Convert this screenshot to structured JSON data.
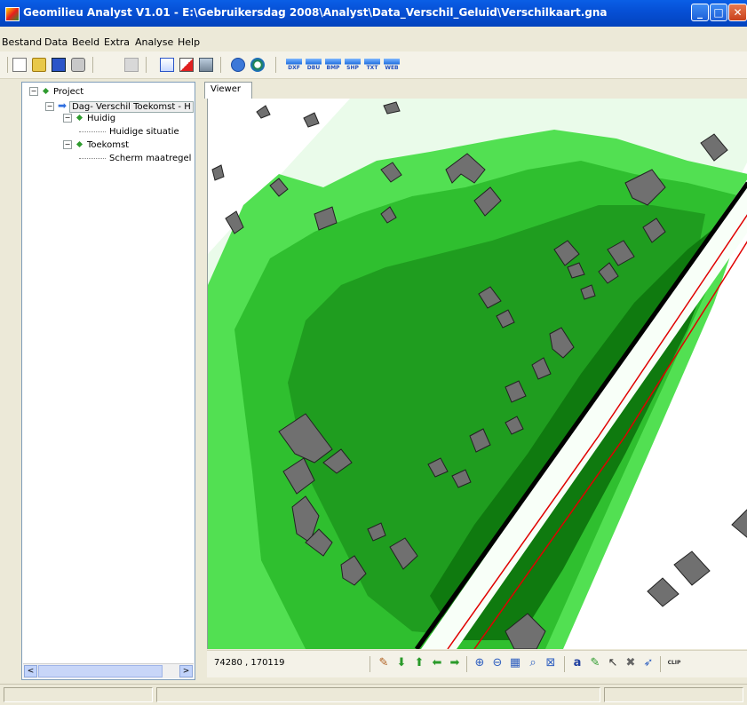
{
  "window": {
    "title": "Geomilieu Analyst V1.01 - E:\\Gebruikersdag 2008\\Analyst\\Data_Verschil_Geluid\\Verschilkaart.gna",
    "app_icon": "geomilieu-logo-icon",
    "controls": [
      "minimize-icon",
      "maximize-icon",
      "close-icon"
    ]
  },
  "menu": {
    "items": [
      "Bestand",
      "Data",
      "Beeld",
      "Extra",
      "Analyse",
      "Help"
    ]
  },
  "toolbar": {
    "icons": [
      "new-icon",
      "open-icon",
      "save-icon",
      "print-icon",
      "disabled-icon",
      "layer-icon",
      "delete-layer-icon",
      "edit-layer-icon",
      "help-icon",
      "info-icon"
    ],
    "export_labels": [
      "DXF",
      "DBU",
      "BMP",
      "SHP",
      "TXT",
      "WEB"
    ]
  },
  "tree": {
    "project": "Project",
    "calc": "Dag- Verschil Toekomst - H",
    "huidig": "Huidig",
    "huidig_child": "Huidige situatie",
    "toekomst": "Toekomst",
    "toekomst_child": "Scherm maatregel"
  },
  "viewer": {
    "tab_label": "Viewer",
    "coordinates": "74280 , 170119",
    "clip_label": "CLIP",
    "nav_icons": [
      "pan-icon",
      "arrow-down-icon",
      "arrow-up-icon",
      "arrow-left-icon",
      "arrow-right-icon",
      "zoom-in-icon",
      "zoom-out-icon",
      "zoom-window-icon",
      "zoom-select-icon",
      "zoom-extent-icon",
      "text-label-icon",
      "pencil-icon",
      "pointer-icon",
      "delete-icon",
      "measure-icon",
      "clip-icon"
    ]
  },
  "colors": {
    "titlebar": "#0a5fe6",
    "map_light_green": "#50e050",
    "map_dark_green": "#0f7a0f",
    "map_pale_green": "#eafbea",
    "building": "#707070",
    "red_line": "#e00000"
  }
}
